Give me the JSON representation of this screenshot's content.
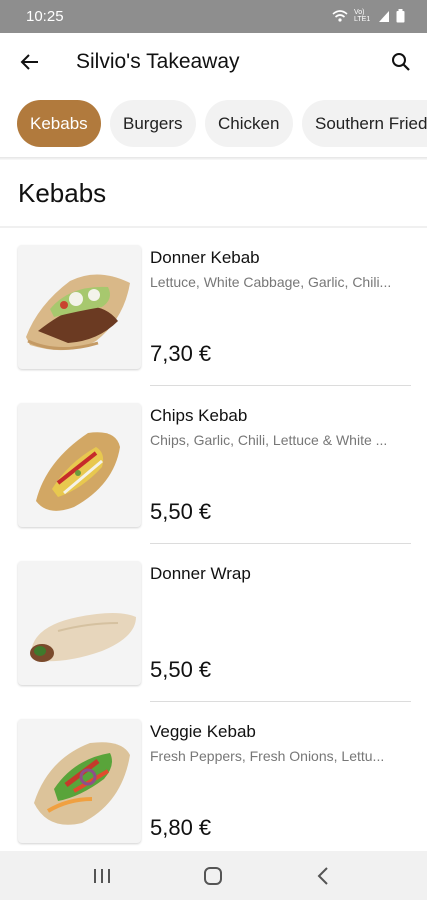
{
  "status": {
    "time": "10:25",
    "network": "Vo) LTE1"
  },
  "header": {
    "title": "Silvio's Takeaway"
  },
  "categories": [
    "Kebabs",
    "Burgers",
    "Chicken",
    "Southern Fried"
  ],
  "section": {
    "title": "Kebabs"
  },
  "items": [
    {
      "name": "Donner Kebab",
      "description": "Lettuce, White Cabbage, Garlic, Chili...",
      "price": "7,30 €"
    },
    {
      "name": "Chips Kebab",
      "description": "Chips, Garlic, Chili, Lettuce & White ...",
      "price": "5,50 €"
    },
    {
      "name": "Donner Wrap",
      "description": "",
      "price": "5,50 €"
    },
    {
      "name": "Veggie Kebab",
      "description": "Fresh Peppers, Fresh Onions, Lettu...",
      "price": "5,80 €"
    }
  ],
  "icons": {
    "back": "arrow-left-icon",
    "search": "search-icon",
    "nav_recents": "recents-icon",
    "nav_home": "home-icon",
    "nav_back": "nav-back-icon"
  },
  "colors": {
    "accent": "#b17a3d",
    "statusbar": "#8e8e8e",
    "chip_bg": "#f2f2f2"
  }
}
